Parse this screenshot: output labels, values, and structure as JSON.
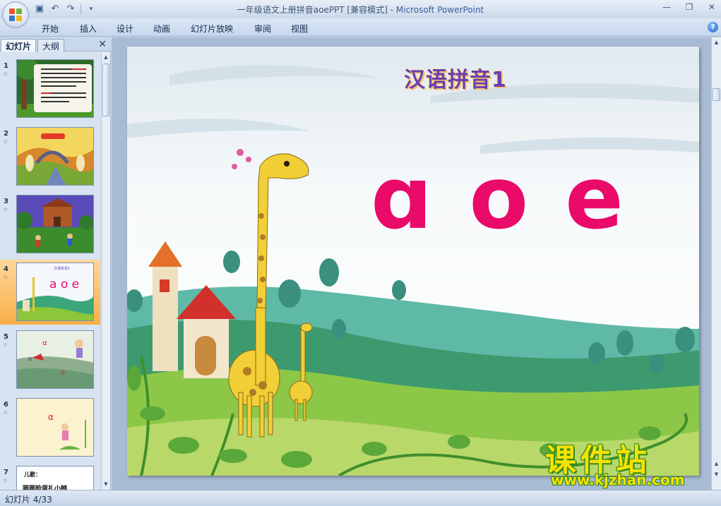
{
  "window": {
    "title": "一年级语文上册拼音aoePPT [兼容模式] - ",
    "app_name": "Microsoft PowerPoint"
  },
  "quick_access": {
    "save_icon": "save-icon",
    "undo_icon": "undo-icon",
    "redo_icon": "redo-icon"
  },
  "ribbon": {
    "tabs": [
      "开始",
      "插入",
      "设计",
      "动画",
      "幻灯片放映",
      "审阅",
      "视图"
    ],
    "help_label": "?"
  },
  "panel": {
    "tab_slides": "幻灯片",
    "tab_outline": "大纲",
    "close_label": "✕"
  },
  "thumbnails": [
    {
      "num": "1"
    },
    {
      "num": "2"
    },
    {
      "num": "3"
    },
    {
      "num": "4",
      "selected": true,
      "title": "汉语拼音1",
      "vowels": "a o e"
    },
    {
      "num": "5",
      "labels": [
        "α",
        "o",
        "e"
      ]
    },
    {
      "num": "6",
      "label": "α"
    },
    {
      "num": "7",
      "lines": [
        "儿歌：",
        "圆圆脸蛋扎小辫"
      ]
    }
  ],
  "slide": {
    "title": "汉语拼音1",
    "vowels": [
      "ɑ",
      "o",
      "e"
    ]
  },
  "watermark": {
    "name": "课件站",
    "url": "www.kjzhan.com"
  },
  "status": {
    "slide_indicator": "幻灯片 4/33"
  },
  "colors": {
    "vowel": "#ea0a6a",
    "selected_thumb": "#f9ae46",
    "title_purple": "#6a3fb0"
  }
}
